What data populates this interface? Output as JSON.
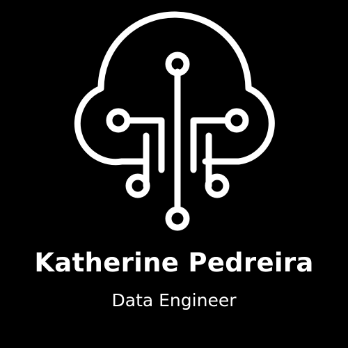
{
  "logo": {
    "icon": "cloud-circuit-icon",
    "background_color": "#000000",
    "foreground_color": "#ffffff"
  },
  "brand": {
    "name": "Katherine Pedreira",
    "title": "Data Engineer"
  }
}
